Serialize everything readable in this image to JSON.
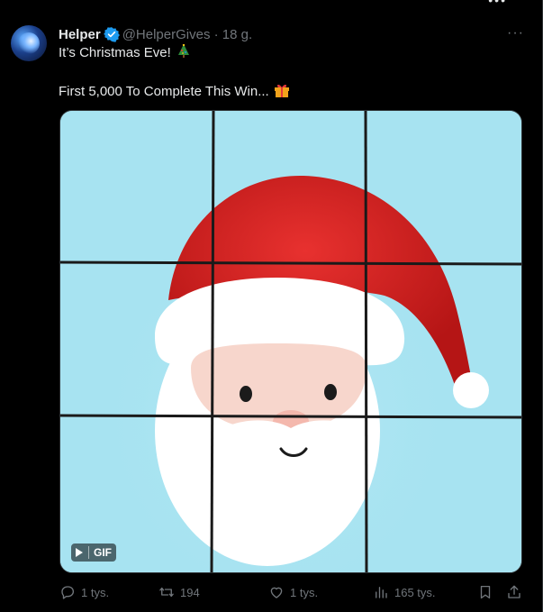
{
  "tweet": {
    "author_name": "Helper",
    "handle": "@HelperGives",
    "separator": "·",
    "time": "18 g.",
    "more_label": "···",
    "line1": "It’s Christmas Eve!",
    "line2": "First 5,000 To Complete This Win..."
  },
  "media": {
    "badge_label": "GIF",
    "puzzle_grid": "3x3"
  },
  "actions": {
    "reply_count": "1 tys.",
    "retweet_count": "194",
    "like_count": "1 tys.",
    "views_count": "165 tys."
  },
  "icons": {
    "verified": "verified-badge-icon",
    "reply": "reply-icon",
    "retweet": "retweet-icon",
    "like": "heart-icon",
    "views": "views-icon",
    "bookmark": "bookmark-icon",
    "share": "share-icon"
  },
  "colors": {
    "background": "#000000",
    "text": "#e7e9ea",
    "muted": "#71767b",
    "verified": "#1d9bf0",
    "sky": "#a7e3f1",
    "santa_red": "#d41f1f"
  }
}
